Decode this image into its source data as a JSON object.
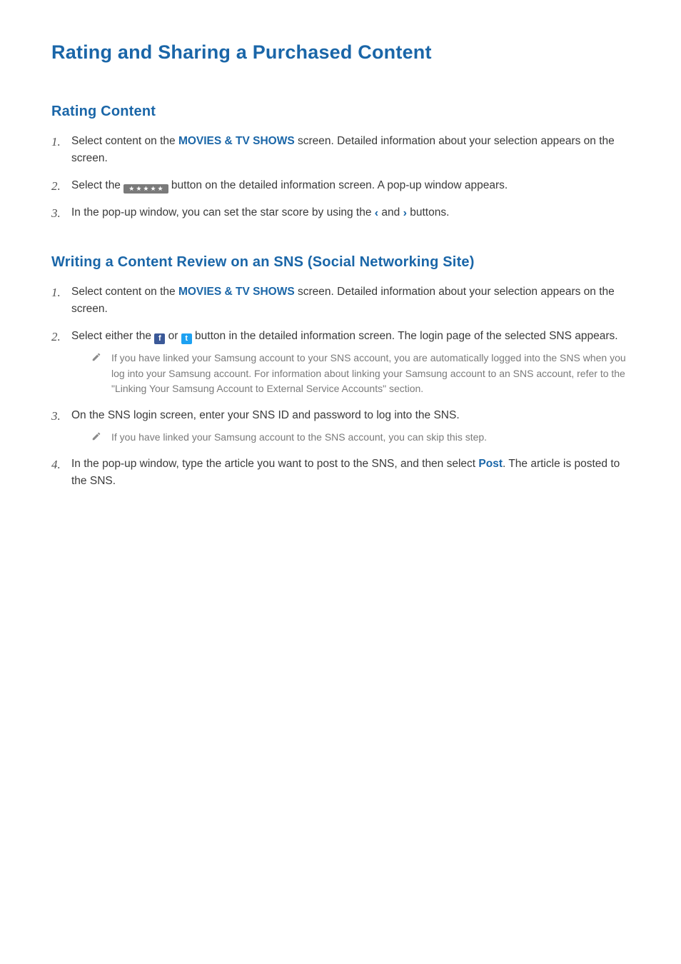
{
  "title": "Rating and Sharing a Purchased Content",
  "section1": {
    "heading": "Rating Content",
    "step1_a": "Select content on the ",
    "step1_link": "MOVIES & TV SHOWS",
    "step1_b": " screen. Detailed information about your selection appears on the screen.",
    "step2_a": "Select the ",
    "step2_b": " button on the detailed information screen. A pop-up window appears.",
    "step3_a": "In the pop-up window, you can set the star score by using the ",
    "step3_and": " and ",
    "step3_b": " buttons.",
    "stars_btn": "★★★★★"
  },
  "section2": {
    "heading": "Writing a Content Review on an SNS (Social Networking Site)",
    "step1_a": "Select content on the ",
    "step1_link": "MOVIES & TV SHOWS",
    "step1_b": " screen. Detailed information about your selection appears on the screen.",
    "step2_a": "Select either the ",
    "step2_or": " or ",
    "step2_b": " button in the detailed information screen. The login page of the selected SNS appears.",
    "note2a": "If you have linked your Samsung account to your SNS account, you are automatically logged into the SNS when you log into your Samsung account. For information about linking your Samsung account to an SNS account, refer to the \"Linking Your Samsung Account to External Service Accounts\" section.",
    "step3": "On the SNS login screen, enter your SNS ID and password to log into the SNS.",
    "note3a": "If you have linked your Samsung account to the SNS account, you can skip this step.",
    "step4_a": "In the pop-up window, type the article you want to post to the SNS, and then select ",
    "step4_post": "Post",
    "step4_b": ". The article is posted to the SNS.",
    "fb_glyph": "f",
    "tw_glyph": "t"
  },
  "nums": {
    "n1": "1.",
    "n2": "2.",
    "n3": "3.",
    "n4": "4."
  }
}
